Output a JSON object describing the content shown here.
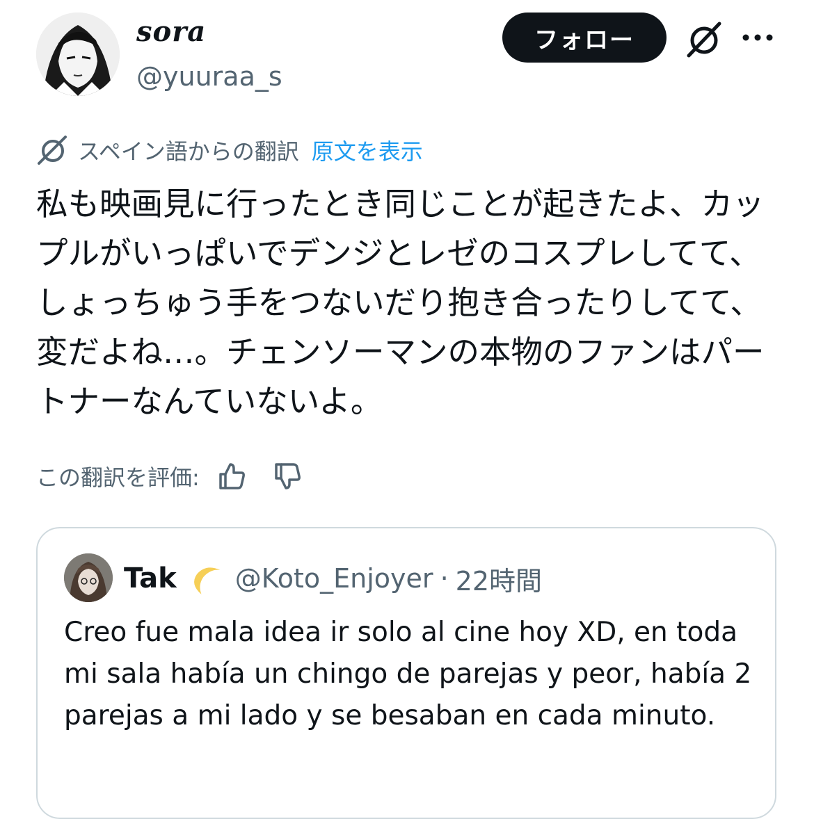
{
  "author": {
    "display_name": "sora",
    "handle": "@yuuraa_s",
    "follow_label": "フォロー"
  },
  "icons": {
    "grok": "grok-slash-icon",
    "more": "more-horizontal-icon",
    "translate": "grok-slash-icon",
    "thumbs_up": "thumbs-up-icon",
    "thumbs_down": "thumbs-down-icon",
    "moon": "crescent-moon-emoji"
  },
  "translation": {
    "from_label": "スペイン語からの翻訳",
    "show_original": "原文を表示",
    "text": "私も映画見に行ったとき同じことが起きたよ、カップルがいっぱいでデンジとレゼのコスプレしてて、しょっちゅう手をつないだり抱き合ったりしてて、変だよね…。チェンソーマンの本物のファンはパートナーなんていないよ。",
    "rate_label": "この翻訳を評価:"
  },
  "quote": {
    "name": "Tak",
    "emoji": "🌙",
    "handle": "@Koto_Enjoyer",
    "separator": "·",
    "time": "22時間",
    "text": "Creo fue mala idea ir solo al cine hoy XD, en toda mi sala había un chingo de parejas y peor, había 2 parejas a mi lado y se besaban en cada minuto."
  },
  "colors": {
    "text": "#0f1419",
    "secondary": "#536471",
    "link": "#1d9bf0",
    "border": "#cfd9de",
    "button": "#0f1419"
  }
}
